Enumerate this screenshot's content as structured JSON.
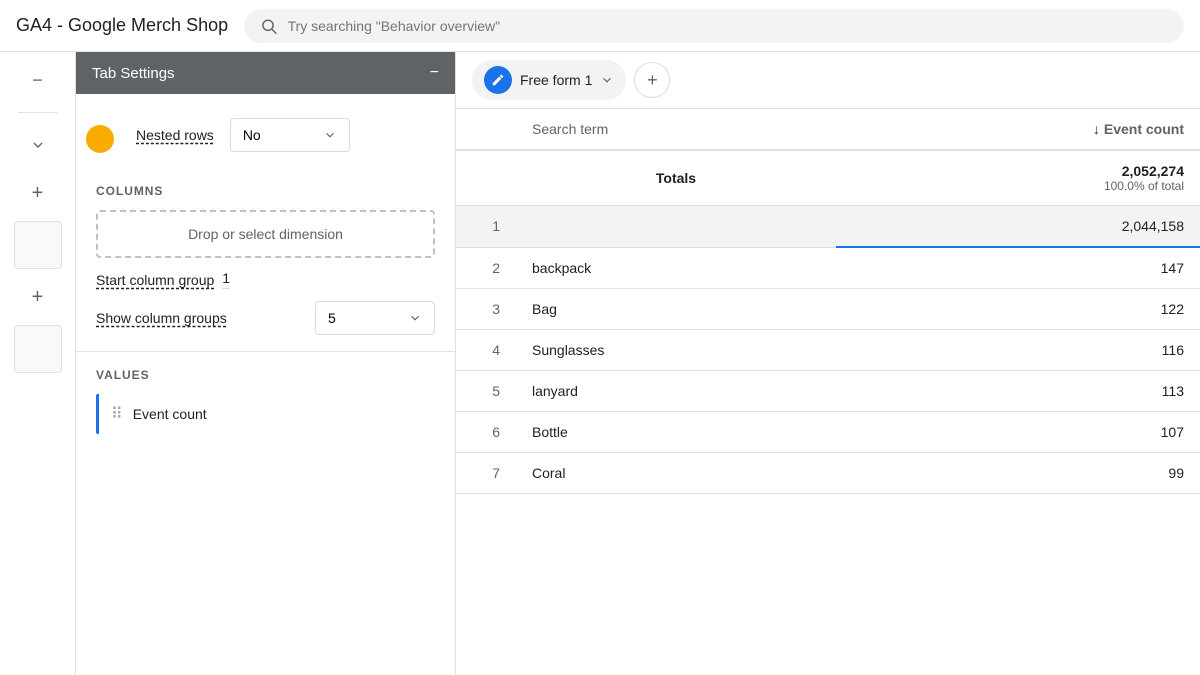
{
  "app": {
    "title": "GA4 - Google Merch Shop",
    "search_placeholder": "Try searching \"Behavior overview\""
  },
  "sidebar": {
    "minus_label": "−",
    "plus_labels": [
      "+",
      "+"
    ]
  },
  "tab_settings": {
    "title": "Tab Settings",
    "close_label": "−",
    "nested_rows_label": "Nested rows",
    "nested_rows_value": "No",
    "columns_title": "COLUMNS",
    "drop_zone_label": "Drop or select dimension",
    "start_column_group_label": "Start column group",
    "start_column_group_value": "1",
    "show_column_groups_label": "Show column groups",
    "show_column_groups_value": "5",
    "values_title": "VALUES",
    "event_count_label": "Event count"
  },
  "tab": {
    "name": "Free form 1",
    "add_label": "+"
  },
  "table": {
    "col1_header": "Search term",
    "col2_header": "Event count",
    "sort_arrow": "↓",
    "totals_label": "Totals",
    "totals_value": "2,052,274",
    "totals_subtext": "100.0% of total",
    "rows": [
      {
        "num": "1",
        "term": "",
        "count": "2,044,158"
      },
      {
        "num": "2",
        "term": "backpack",
        "count": "147"
      },
      {
        "num": "3",
        "term": "Bag",
        "count": "122"
      },
      {
        "num": "4",
        "term": "Sunglasses",
        "count": "116"
      },
      {
        "num": "5",
        "term": "lanyard",
        "count": "113"
      },
      {
        "num": "6",
        "term": "Bottle",
        "count": "107"
      },
      {
        "num": "7",
        "term": "Coral",
        "count": "99"
      }
    ]
  }
}
